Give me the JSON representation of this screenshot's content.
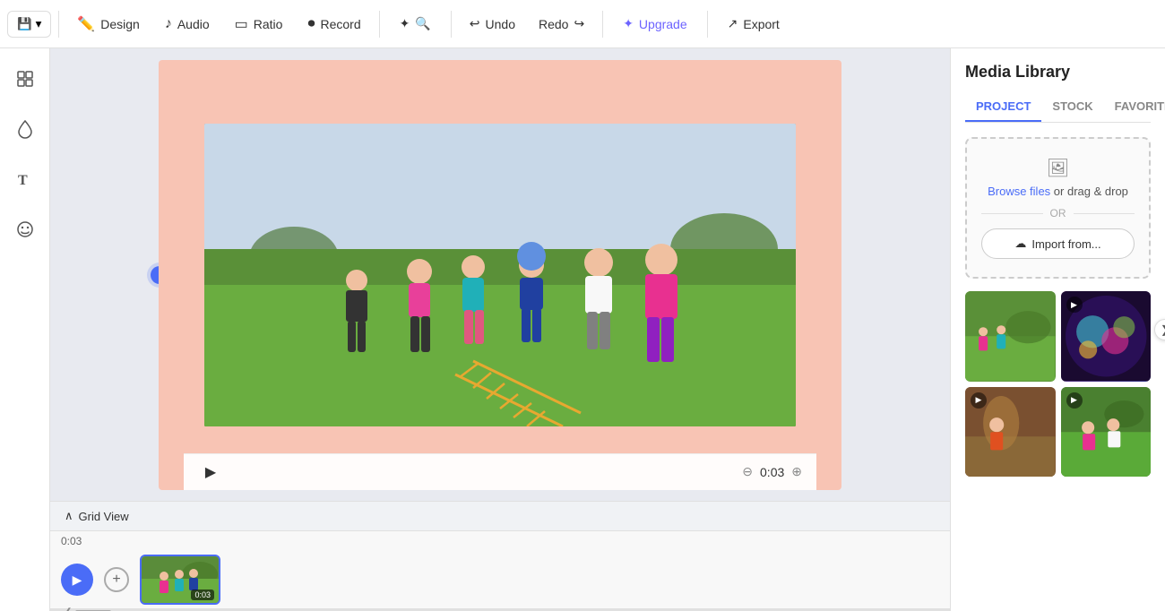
{
  "toolbar": {
    "save_icon": "💾",
    "save_dropdown_icon": "▾",
    "design_label": "Design",
    "design_icon": "✏️",
    "audio_label": "Audio",
    "audio_icon": "♪",
    "ratio_label": "Ratio",
    "ratio_icon": "▭",
    "record_label": "Record",
    "record_icon": "⏺",
    "search_icon": "✦",
    "search_plus": "🔍",
    "undo_label": "Undo",
    "undo_icon": "↩",
    "redo_label": "Redo",
    "redo_icon": "↪",
    "upgrade_label": "Upgrade",
    "upgrade_icon": "✦",
    "export_label": "Export",
    "export_icon": "↗"
  },
  "left_sidebar": {
    "icons": [
      "grid",
      "drop",
      "text",
      "smile"
    ]
  },
  "video": {
    "time": "0:03"
  },
  "right_panel": {
    "title": "Media Library",
    "tabs": [
      "PROJECT",
      "STOCK",
      "FAVORITES"
    ],
    "active_tab": "PROJECT",
    "upload": {
      "browse_text": "Browse files",
      "or_text": "or drag & drop",
      "or_divider": "OR",
      "import_label": "Import from..."
    },
    "thumbnails": [
      {
        "id": 1,
        "has_video": false,
        "color": "thumb-1"
      },
      {
        "id": 2,
        "has_video": true,
        "color": "thumb-2"
      },
      {
        "id": 3,
        "has_video": true,
        "color": "thumb-3"
      },
      {
        "id": 4,
        "has_video": true,
        "color": "thumb-4"
      }
    ]
  },
  "grid_view": {
    "label": "Grid View",
    "chevron": "∧"
  },
  "timeline": {
    "time": "0:03",
    "play_icon": "▶",
    "add_icon": "+",
    "clip_time": "0:03",
    "scroll_arrow": "❯"
  }
}
